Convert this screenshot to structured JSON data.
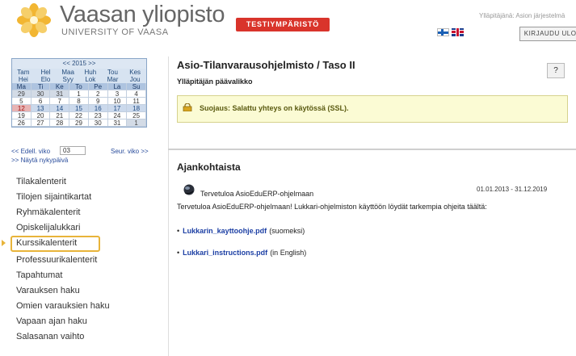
{
  "header": {
    "logo_icon": "yellow-flower-logo",
    "title": "Vaasan yliopisto",
    "subtitle": "UNIVERSITY OF VAASA",
    "environment_badge": "TESTIYMPÄRISTÖ",
    "user_info": "Ylläpitäjänä: Asion järjestelmä",
    "logout_label": "KIRJAUDU ULOS",
    "lang_fi": "finnish-flag",
    "lang_en": "english-flag"
  },
  "calendar": {
    "year_nav": "<< 2015 >>",
    "months": [
      [
        "Tam",
        "Hel",
        "Maa",
        "Huh",
        "Tou",
        "Kes"
      ],
      [
        "Hei",
        "Elo",
        "Syy",
        "Lok",
        "Mar",
        "Jou"
      ]
    ],
    "weekdays": [
      "Ma",
      "Ti",
      "Ke",
      "To",
      "Pe",
      "La",
      "Su"
    ],
    "weeks": [
      [
        "29",
        "30",
        "31",
        "1",
        "2",
        "3",
        "4"
      ],
      [
        "5",
        "6",
        "7",
        "8",
        "9",
        "10",
        "11"
      ],
      [
        "12",
        "13",
        "14",
        "15",
        "16",
        "17",
        "18"
      ],
      [
        "19",
        "20",
        "21",
        "22",
        "23",
        "24",
        "25"
      ],
      [
        "26",
        "27",
        "28",
        "29",
        "30",
        "31",
        "1"
      ]
    ],
    "prev_week": "<< Edell. viko",
    "week_number": "03",
    "next_week": "Seur. viko >>",
    "show_current": ">> Näytä nykypäivä",
    "colors": {
      "header": "#aec4e0",
      "today": "#e8b4b4"
    }
  },
  "sidebar": {
    "items": [
      {
        "label": "Tilakalenterit"
      },
      {
        "label": "Tilojen sijaintikartat"
      },
      {
        "label": "Ryhmäkalenterit"
      },
      {
        "label": "Opiskelijalukkari"
      },
      {
        "label": "Kurssikalenterit"
      },
      {
        "label": "Professuurikalenterit"
      },
      {
        "label": "Tapahtumat"
      },
      {
        "label": "Varauksen haku"
      },
      {
        "label": "Omien varauksien haku"
      },
      {
        "label": "Vapaan ajan haku"
      },
      {
        "label": "Salasanan vaihto"
      }
    ],
    "selected_index": 4,
    "selected_color": "#e8b43a"
  },
  "main": {
    "title": "Asio-Tilanvarausohjelmisto / Taso II",
    "subtitle": "Ylläpitäjän päävalikko",
    "help_label": "?",
    "security_text": "Suojaus: Salattu yhteys on käytössä (SSL).",
    "security_icon": "lock-icon",
    "news_heading": "Ajankohtaista",
    "news": {
      "icon": "globe-icon",
      "title": "Tervetuloa AsioEduERP-ohjelmaan",
      "date_range": "01.01.2013 - 31.12.2019",
      "body": "Tervetuloa AsioEduERP-ohjelmaan! Lukkari-ohjelmiston käyttöön löydät tarkempia ohjeita täältä:",
      "links": [
        {
          "text": "Lukkarin_kayttoohje.pdf",
          "note": "(suomeksi)"
        },
        {
          "text": "Lukkari_instructions.pdf",
          "note": "(in English)"
        }
      ]
    }
  }
}
